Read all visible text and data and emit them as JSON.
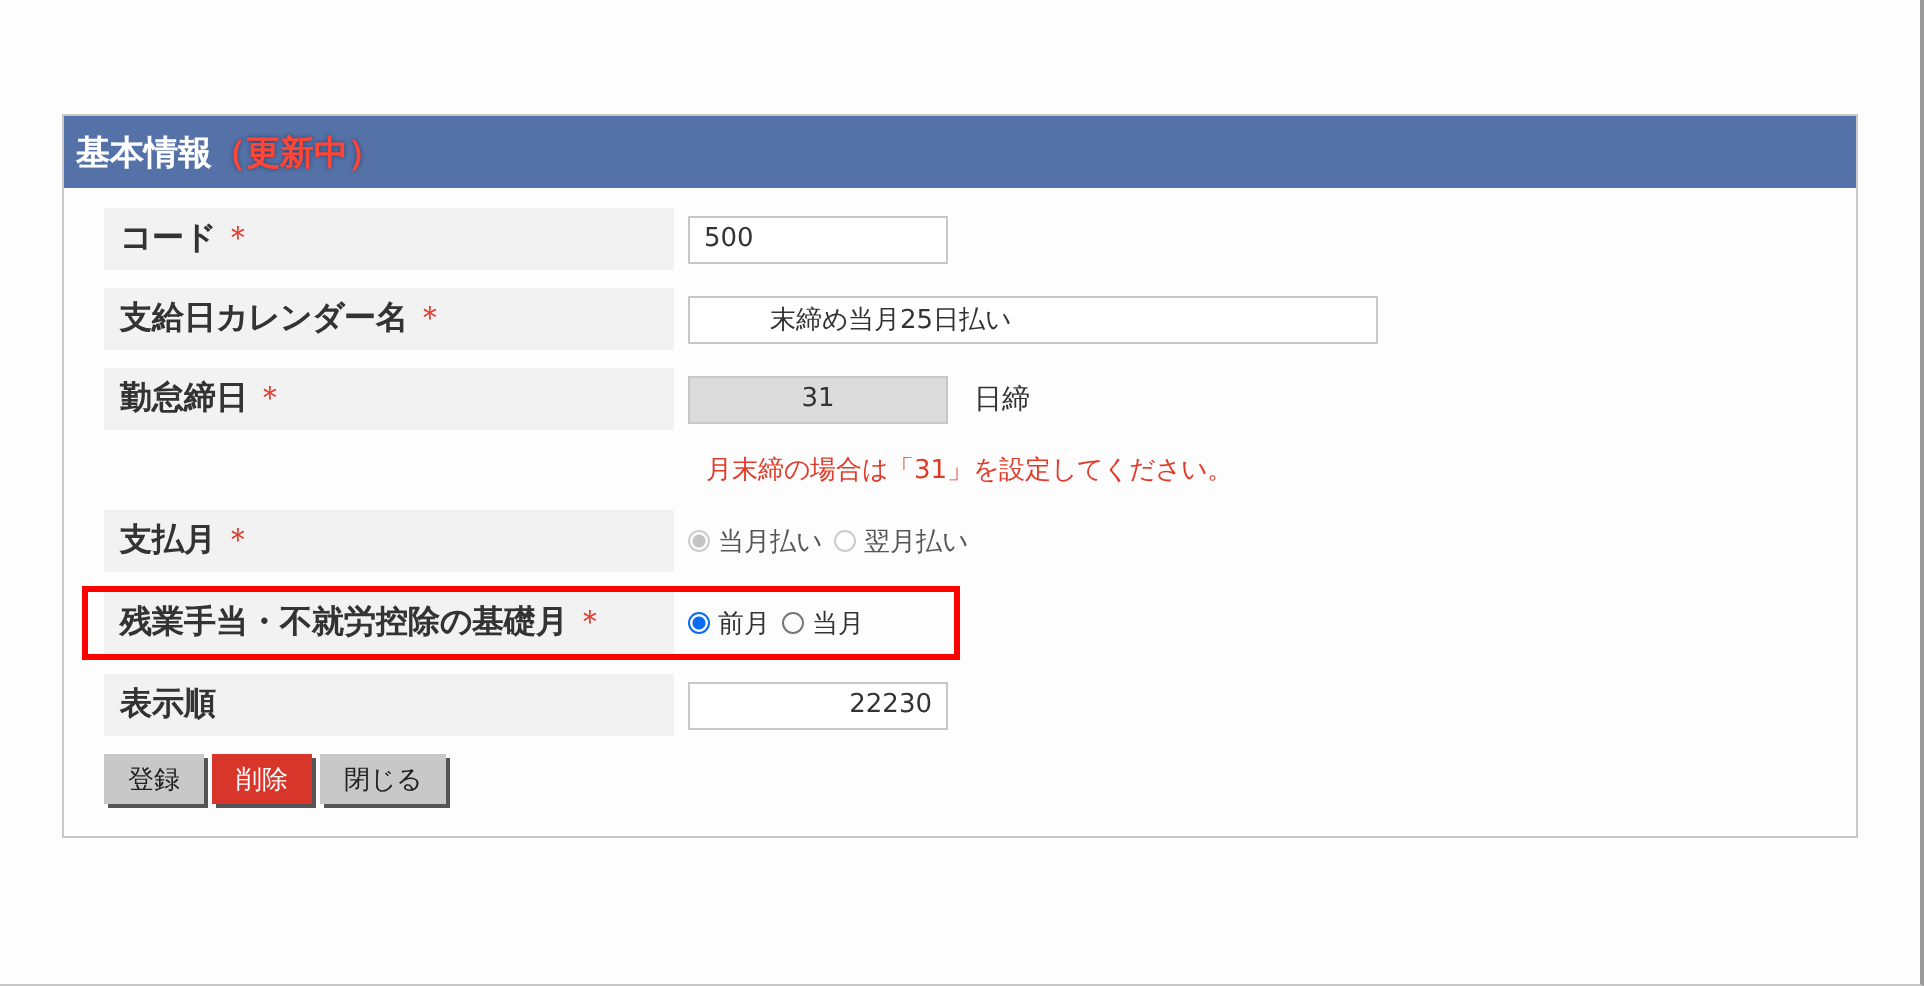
{
  "panel": {
    "title": "基本情報",
    "status": "（更新中）"
  },
  "fields": [
    {
      "kind": "text",
      "label": "コード",
      "required_mark": "＊",
      "highlighted": false,
      "input": {
        "value": "500",
        "kind": "plain",
        "disabled": false
      }
    },
    {
      "kind": "text",
      "label": "支給日カレンダー名",
      "required_mark": "＊",
      "highlighted": false,
      "input": {
        "value": "末締め当月25日払い",
        "kind": "indented",
        "disabled": false
      }
    },
    {
      "kind": "text",
      "label": "勤怠締日",
      "required_mark": "＊",
      "highlighted": false,
      "input": {
        "value": "31",
        "kind": "centered",
        "disabled": true
      },
      "suffix": "日締"
    },
    {
      "kind": "note",
      "text": "月末締の場合は「31」を設定してください。"
    },
    {
      "kind": "radio",
      "label": "支払月",
      "required_mark": "＊",
      "highlighted": false,
      "disabled": true,
      "options": [
        {
          "label": "当月払い",
          "selected": true
        },
        {
          "label": "翌月払い",
          "selected": false
        }
      ]
    },
    {
      "kind": "radio",
      "label": "残業手当・不就労控除の基礎月",
      "required_mark": "＊",
      "highlighted": true,
      "disabled": false,
      "options": [
        {
          "label": "前月",
          "selected": true
        },
        {
          "label": "当月",
          "selected": false
        }
      ]
    },
    {
      "kind": "text",
      "label": "表示順",
      "highlighted": false,
      "input": {
        "value": "22230",
        "kind": "numeric",
        "disabled": false
      }
    }
  ],
  "buttons": [
    {
      "label": "登録",
      "kind": "default"
    },
    {
      "label": "削除",
      "kind": "danger"
    },
    {
      "label": "閉じる",
      "kind": "default"
    }
  ]
}
